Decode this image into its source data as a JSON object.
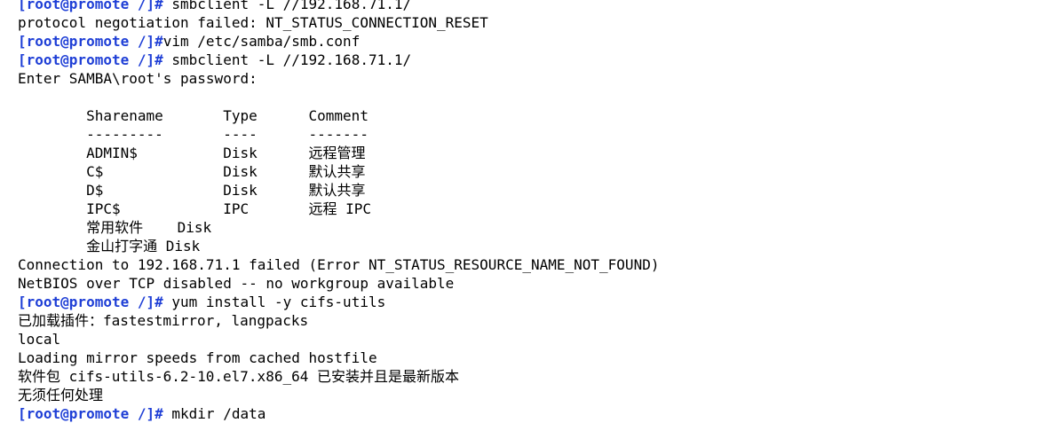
{
  "terminal": {
    "prompt": "[root@promote /]#",
    "lines": [
      {
        "prompt": true,
        "text": " smbclient -L //192.168.71.1/"
      },
      {
        "prompt": false,
        "text": "protocol negotiation failed: NT_STATUS_CONNECTION_RESET"
      },
      {
        "prompt": true,
        "text": "vim /etc/samba/smb.conf"
      },
      {
        "prompt": true,
        "text": " smbclient -L //192.168.71.1/"
      },
      {
        "prompt": false,
        "text": "Enter SAMBA\\root's password:"
      },
      {
        "prompt": false,
        "text": ""
      },
      {
        "prompt": false,
        "text": "        Sharename       Type      Comment"
      },
      {
        "prompt": false,
        "text": "        ---------       ----      -------"
      },
      {
        "prompt": false,
        "text": "        ADMIN$          Disk      远程管理"
      },
      {
        "prompt": false,
        "text": "        C$              Disk      默认共享"
      },
      {
        "prompt": false,
        "text": "        D$              Disk      默认共享"
      },
      {
        "prompt": false,
        "text": "        IPC$            IPC       远程 IPC"
      },
      {
        "prompt": false,
        "text": "        常用软件    Disk"
      },
      {
        "prompt": false,
        "text": "        金山打字通 Disk"
      },
      {
        "prompt": false,
        "text": "Connection to 192.168.71.1 failed (Error NT_STATUS_RESOURCE_NAME_NOT_FOUND)"
      },
      {
        "prompt": false,
        "text": "NetBIOS over TCP disabled -- no workgroup available"
      },
      {
        "prompt": true,
        "text": " yum install -y cifs-utils"
      },
      {
        "prompt": false,
        "text": "已加载插件：fastestmirror, langpacks"
      },
      {
        "prompt": false,
        "text": "local"
      },
      {
        "prompt": false,
        "text": "Loading mirror speeds from cached hostfile"
      },
      {
        "prompt": false,
        "text": "软件包 cifs-utils-6.2-10.el7.x86_64 已安装并且是最新版本"
      },
      {
        "prompt": false,
        "text": "无须任何处理"
      },
      {
        "prompt": true,
        "text": " mkdir /data"
      }
    ]
  },
  "colors": {
    "background": "#ffffff",
    "text": "#000000",
    "prompt": "#1f3fd6"
  }
}
